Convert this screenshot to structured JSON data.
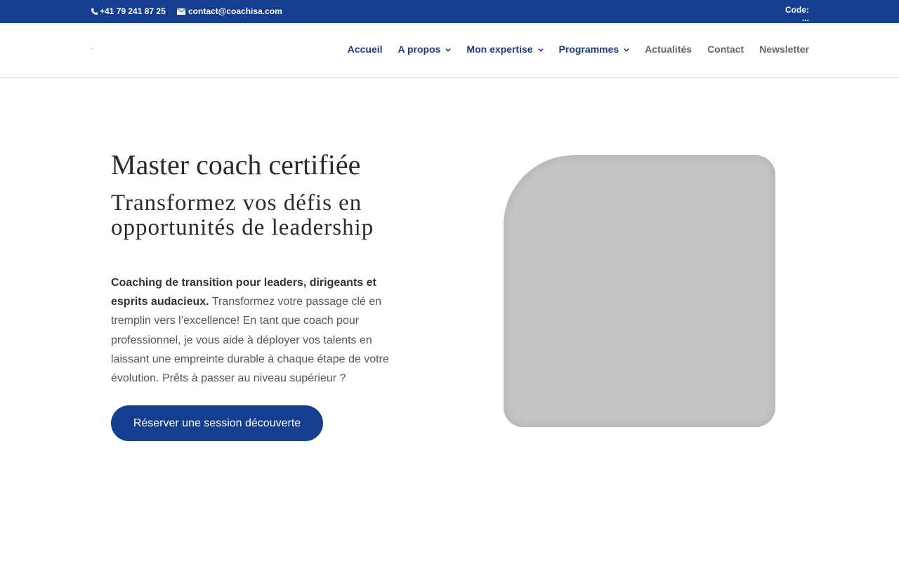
{
  "topbar": {
    "phone": "+41 79 241 87 25",
    "email": "contact@coachisa.com",
    "code_label": "Code:",
    "code_value": "..."
  },
  "nav": {
    "items": [
      {
        "label": "Accueil",
        "has_dropdown": false
      },
      {
        "label": "A propos",
        "has_dropdown": true
      },
      {
        "label": "Mon expertise",
        "has_dropdown": true
      },
      {
        "label": "Programmes",
        "has_dropdown": true
      },
      {
        "label": "Actualités",
        "has_dropdown": false
      },
      {
        "label": "Contact",
        "has_dropdown": false
      },
      {
        "label": "Newsletter",
        "has_dropdown": false
      }
    ]
  },
  "hero": {
    "title": "Master coach certifiée",
    "subtitle": "Transformez vos défis en opportunités de leadership",
    "intro_bold": "Coaching de transition pour leaders, dirigeants et esprits audacieux.",
    "intro_text": " Transformez votre passage clé en tremplin vers l’excellence! En tant que coach pour professionnel, je vous aide à déployer vos talents en laissant une empreinte durable à chaque étape de votre évolution. Prêts à passer au niveau supérieur ?",
    "cta_label": "Réserver une session découverte"
  },
  "colors": {
    "brand_blue": "#153e91",
    "nav_primary": "#1f3d7a",
    "nav_secondary": "#666666",
    "image_placeholder": "#c4c4c4"
  },
  "icons": {
    "phone": "phone-icon",
    "email": "mail-icon",
    "dropdown": "chevron-down-icon"
  }
}
